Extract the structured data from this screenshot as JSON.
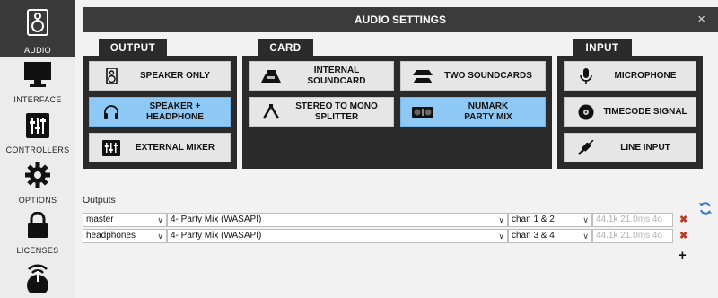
{
  "sidebar": {
    "items": [
      {
        "label": "AUDIO",
        "icon": "speaker-icon"
      },
      {
        "label": "INTERFACE",
        "icon": "monitor-icon"
      },
      {
        "label": "CONTROLLERS",
        "icon": "sliders-icon"
      },
      {
        "label": "OPTIONS",
        "icon": "gear-icon"
      },
      {
        "label": "LICENSES",
        "icon": "lock-icon"
      },
      {
        "label": "",
        "icon": "broadcast-icon"
      }
    ]
  },
  "window": {
    "title": "AUDIO SETTINGS",
    "close": "×"
  },
  "groups": {
    "output": "OUTPUT",
    "card": "CARD",
    "input": "INPUT"
  },
  "output_buttons": [
    "SPEAKER ONLY",
    "SPEAKER +\nHEADPHONE",
    "EXTERNAL MIXER"
  ],
  "card_buttons": [
    "INTERNAL\nSOUNDCARD",
    "TWO SOUNDCARDS",
    "STEREO TO MONO\nSPLITTER",
    "NUMARK\nPARTY MIX"
  ],
  "input_buttons": [
    "MICROPHONE",
    "TIMECODE SIGNAL",
    "LINE INPUT"
  ],
  "outputs": {
    "label": "Outputs",
    "rows": [
      {
        "name": "master",
        "device": "4- Party Mix (WASAPI)",
        "channels": "chan 1 & 2",
        "info": "44.1k 21.0ms 4o"
      },
      {
        "name": "headphones",
        "device": "4- Party Mix (WASAPI)",
        "channels": "chan 3 & 4",
        "info": "44.1k 21.0ms 4o"
      }
    ],
    "add": "+"
  },
  "colors": {
    "selected": "#8ec8f5",
    "panel": "#2b2b2b",
    "delete": "#c0392b"
  }
}
